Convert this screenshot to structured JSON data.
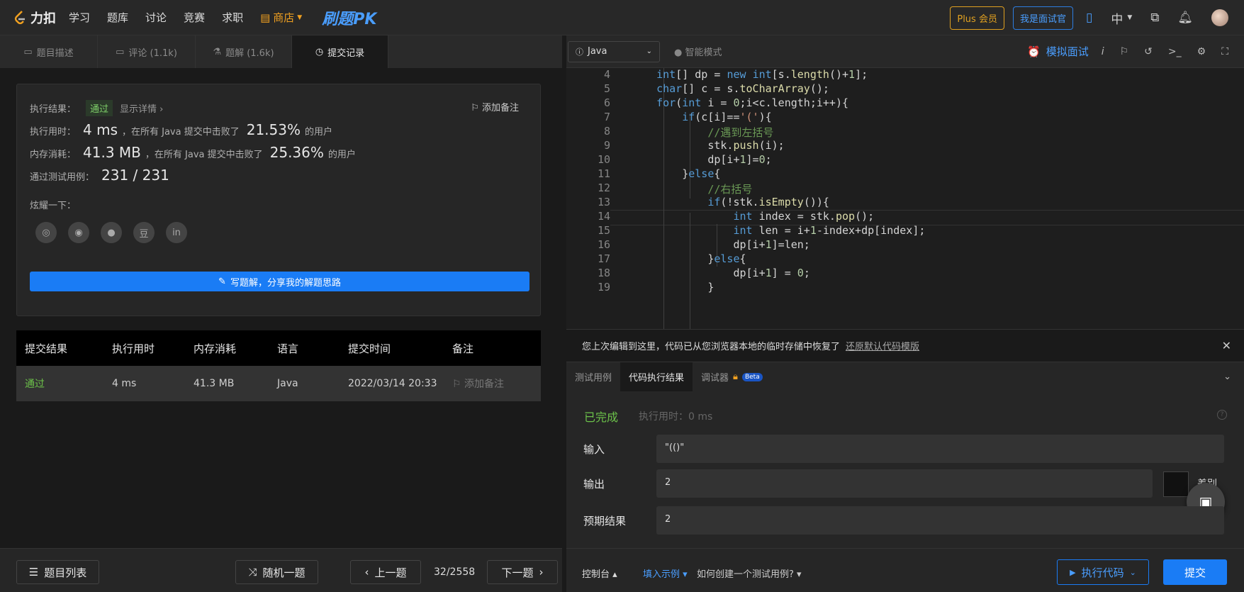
{
  "nav": {
    "logo": "力扣",
    "items": [
      "学习",
      "题库",
      "讨论",
      "竞赛",
      "求职"
    ],
    "shop": "商店",
    "pk": "刷题PK",
    "plus": "Plus 会员",
    "interviewer": "我是面试官",
    "lang": "中"
  },
  "left_tabs": [
    {
      "label": "题目描述",
      "icon": "doc-icon"
    },
    {
      "label": "评论 (1.1k)",
      "icon": "comment-icon"
    },
    {
      "label": "题解 (1.6k)",
      "icon": "flask-icon"
    },
    {
      "label": "提交记录",
      "icon": "clock-icon"
    }
  ],
  "result": {
    "label": "执行结果：",
    "status": "通过",
    "detail": "显示详情 ›",
    "add_note": "添加备注",
    "time_label": "执行用时：",
    "time_value": "4 ms",
    "time_text": "，在所有 Java 提交中击败了",
    "time_pct": "21.53%",
    "users": "的用户",
    "mem_label": "内存消耗：",
    "mem_value": "41.3 MB",
    "mem_text": "，在所有 Java 提交中击败了",
    "mem_pct": "25.36%",
    "cases_label": "通过测试用例：",
    "cases_value": "231 / 231",
    "share_label": "炫耀一下：",
    "write": "写题解，分享我的解题思路"
  },
  "table": {
    "headers": [
      "提交结果",
      "执行用时",
      "内存消耗",
      "语言",
      "提交时间",
      "备注"
    ],
    "rows": [
      {
        "result": "通过",
        "time": "4 ms",
        "memory": "41.3 MB",
        "lang": "Java",
        "submitted": "2022/03/14 20:33",
        "note": "添加备注"
      }
    ]
  },
  "left_bottom": {
    "list": "题目列表",
    "random": "随机一题",
    "prev": "上一题",
    "page": "32/2558",
    "next": "下一题"
  },
  "editor_toolbar": {
    "language": "Java",
    "smart": "智能模式",
    "mock": "模拟面试"
  },
  "code": {
    "lines": [
      {
        "n": "4"
      },
      {
        "n": "5"
      },
      {
        "n": "6"
      },
      {
        "n": "7"
      },
      {
        "n": "8"
      },
      {
        "n": "9"
      },
      {
        "n": "10"
      },
      {
        "n": "11"
      },
      {
        "n": "12"
      },
      {
        "n": "13"
      },
      {
        "n": "14"
      },
      {
        "n": "15"
      },
      {
        "n": "16"
      },
      {
        "n": "17"
      },
      {
        "n": "18"
      },
      {
        "n": "19"
      }
    ]
  },
  "restore": {
    "text": "您上次编辑到这里，代码已从您浏览器本地的临时存储中恢复了",
    "link": "还原默认代码模版"
  },
  "console_tabs": [
    "测试用例",
    "代码执行结果",
    "调试器"
  ],
  "beta": "Beta",
  "console": {
    "status": "已完成",
    "exec_time": "执行用时：0 ms",
    "input_label": "输入",
    "input_value": "\"(()\"",
    "output_label": "输出",
    "output_value": "2",
    "diff": "差别",
    "expected_label": "预期结果",
    "expected_value": "2"
  },
  "right_bottom": {
    "console": "控制台 ▴",
    "fill": "填入示例 ▾",
    "how": "如何创建一个测试用例? ▾",
    "run": "执行代码",
    "submit": "提交"
  }
}
